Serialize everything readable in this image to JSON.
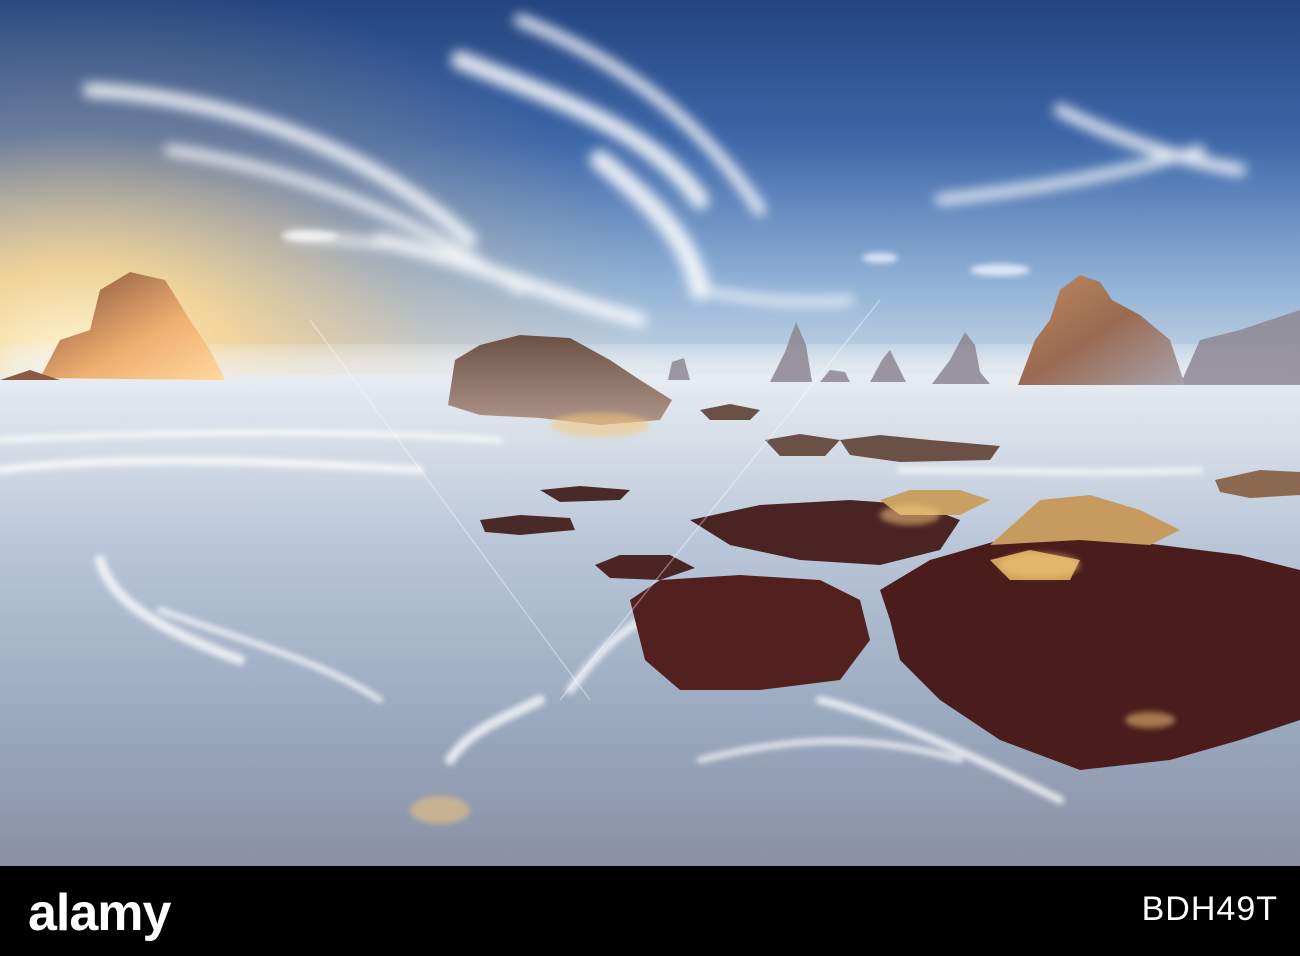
{
  "footer": {
    "brand_logo_text": "alamy",
    "image_id": "BDH49T"
  },
  "watermark": {
    "text": "alamy"
  },
  "colors": {
    "sky_top": "#2b4f8f",
    "sky_mid": "#5f8ac4",
    "horizon_glow": "#ffe2a8",
    "sea": "#c9d4e2",
    "rock_dark": "#3a1d1c",
    "rock_lit": "#d8a35a",
    "footer_bg": "#000000"
  }
}
